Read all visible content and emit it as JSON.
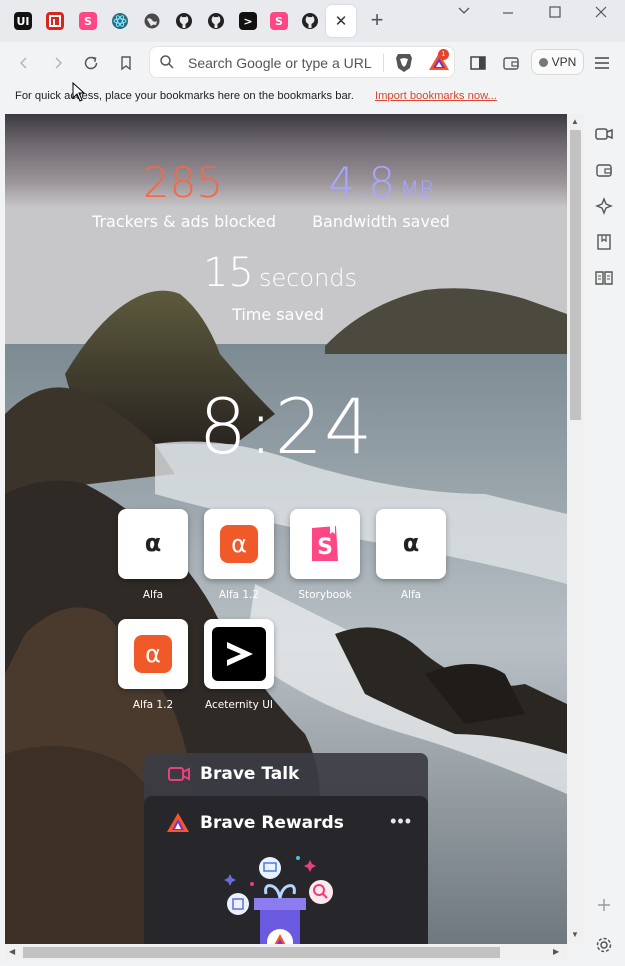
{
  "tabs": [
    {
      "name": "aceternity-ui",
      "glyph": "UI",
      "bg": "#111111"
    },
    {
      "name": "red-box",
      "glyph": "Π",
      "bg": "#d9261c"
    },
    {
      "name": "storybook",
      "glyph": "S",
      "bg": "#ff4785"
    },
    {
      "name": "react",
      "glyph": "⚛",
      "bg": "#e9eaee"
    },
    {
      "name": "globe",
      "glyph": "◍",
      "bg": "#e9eaee"
    },
    {
      "name": "github",
      "glyph": "●",
      "bg": "#e9eaee"
    },
    {
      "name": "github",
      "glyph": "●",
      "bg": "#e9eaee"
    },
    {
      "name": "aceternity",
      "glyph": ">",
      "bg": "#111111"
    },
    {
      "name": "storybook",
      "glyph": "S",
      "bg": "#ff4785"
    },
    {
      "name": "github",
      "glyph": "●",
      "bg": "#e9eaee"
    }
  ],
  "active_tab_close": "✕",
  "new_tab": "+",
  "window": {
    "minimize": "⌄",
    "restore": "—",
    "maximize": "☐",
    "close": "✕"
  },
  "toolbar": {
    "search_placeholder": "Search Google or type a URL",
    "rewards_badge": "1",
    "vpn_label": "VPN"
  },
  "bookmarks_bar": {
    "text": "For quick access, place your bookmarks here on the bookmarks bar.",
    "link": "Import bookmarks now..."
  },
  "stats": {
    "trackers_value": "285",
    "trackers_label": "Trackers & ads blocked",
    "bandwidth_value": "4.8",
    "bandwidth_unit": "MB",
    "bandwidth_label": "Bandwidth saved",
    "time_value": "15",
    "time_unit": "seconds",
    "time_label": "Time saved"
  },
  "clock": "8:24",
  "top_sites": [
    {
      "label": "Alfa",
      "icon": "alpha-dark"
    },
    {
      "label": "Alfa 1.2",
      "icon": "alpha-orange"
    },
    {
      "label": "Storybook",
      "icon": "storybook"
    },
    {
      "label": "Alfa",
      "icon": "alpha-dark"
    },
    {
      "label": "Alfa 1.2",
      "icon": "alpha-orange"
    },
    {
      "label": "Aceternity UI",
      "icon": "aceternity"
    }
  ],
  "widgets": {
    "talk_title": "Brave Talk",
    "rewards_title": "Brave Rewards",
    "rewards_menu": "•••"
  },
  "colors": {
    "trackers": "#ef6a4b",
    "bandwidth": "#a9a6ff",
    "accent_link": "#d9462f",
    "brave_orange": "#fb542b"
  }
}
